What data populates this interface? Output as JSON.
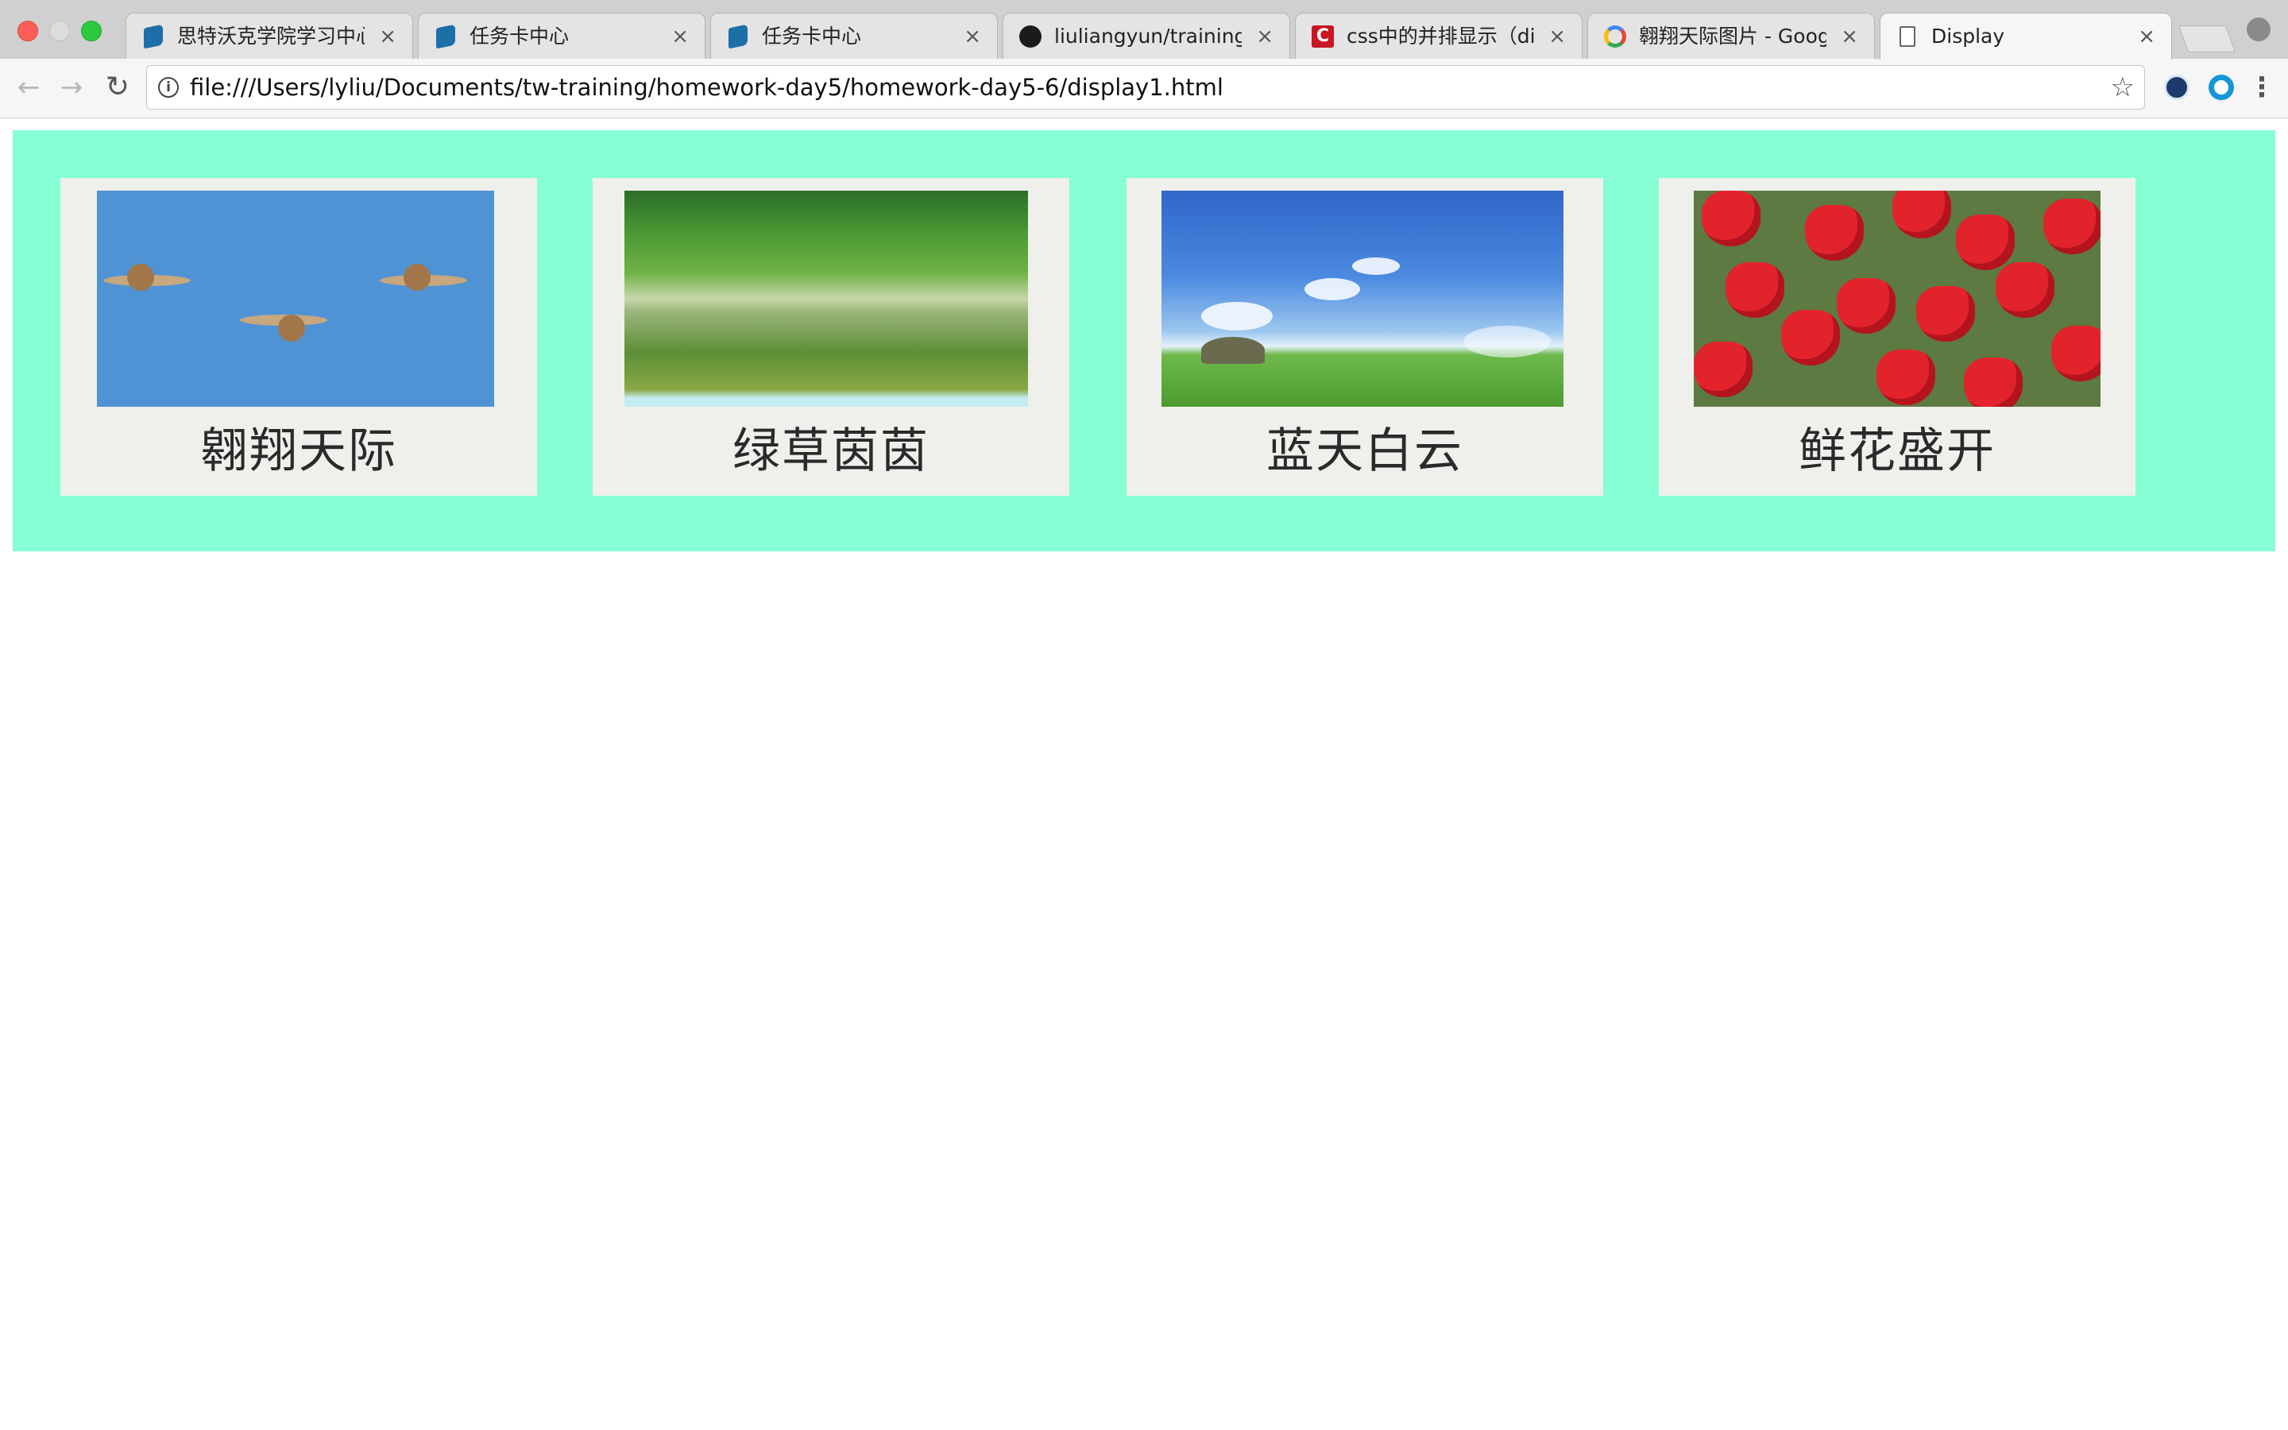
{
  "browser": {
    "tabs": [
      {
        "label": "思特沃克学院学习中心",
        "favicon": "book-icon",
        "active": false
      },
      {
        "label": "任务卡中心",
        "favicon": "book-icon",
        "active": false
      },
      {
        "label": "任务卡中心",
        "favicon": "book-icon",
        "active": false
      },
      {
        "label": "liuliangyun/training-ho",
        "favicon": "github-icon",
        "active": false
      },
      {
        "label": "css中的并排显示（div/",
        "favicon": "csdn-icon",
        "active": false
      },
      {
        "label": "翱翔天际图片 - Google",
        "favicon": "google-icon",
        "active": false
      },
      {
        "label": "Display",
        "favicon": "document-icon",
        "active": true
      }
    ],
    "close_glyph": "×",
    "address": "file:///Users/lyliu/Documents/tw-training/homework-day5/homework-day5-6/display1.html",
    "colors": {
      "tabstrip": "#d0d0d0",
      "toolbar": "#f6f6f6"
    }
  },
  "page": {
    "background": "#85ffd3",
    "cards": [
      {
        "caption": "翱翔天际",
        "image": "birds-flying-in-blue-sky"
      },
      {
        "caption": "绿草茵茵",
        "image": "green-grassland-with-sheep"
      },
      {
        "caption": "蓝天白云",
        "image": "blue-sky-white-clouds-green-field"
      },
      {
        "caption": "鲜花盛开",
        "image": "red-tulips-blooming"
      }
    ]
  }
}
